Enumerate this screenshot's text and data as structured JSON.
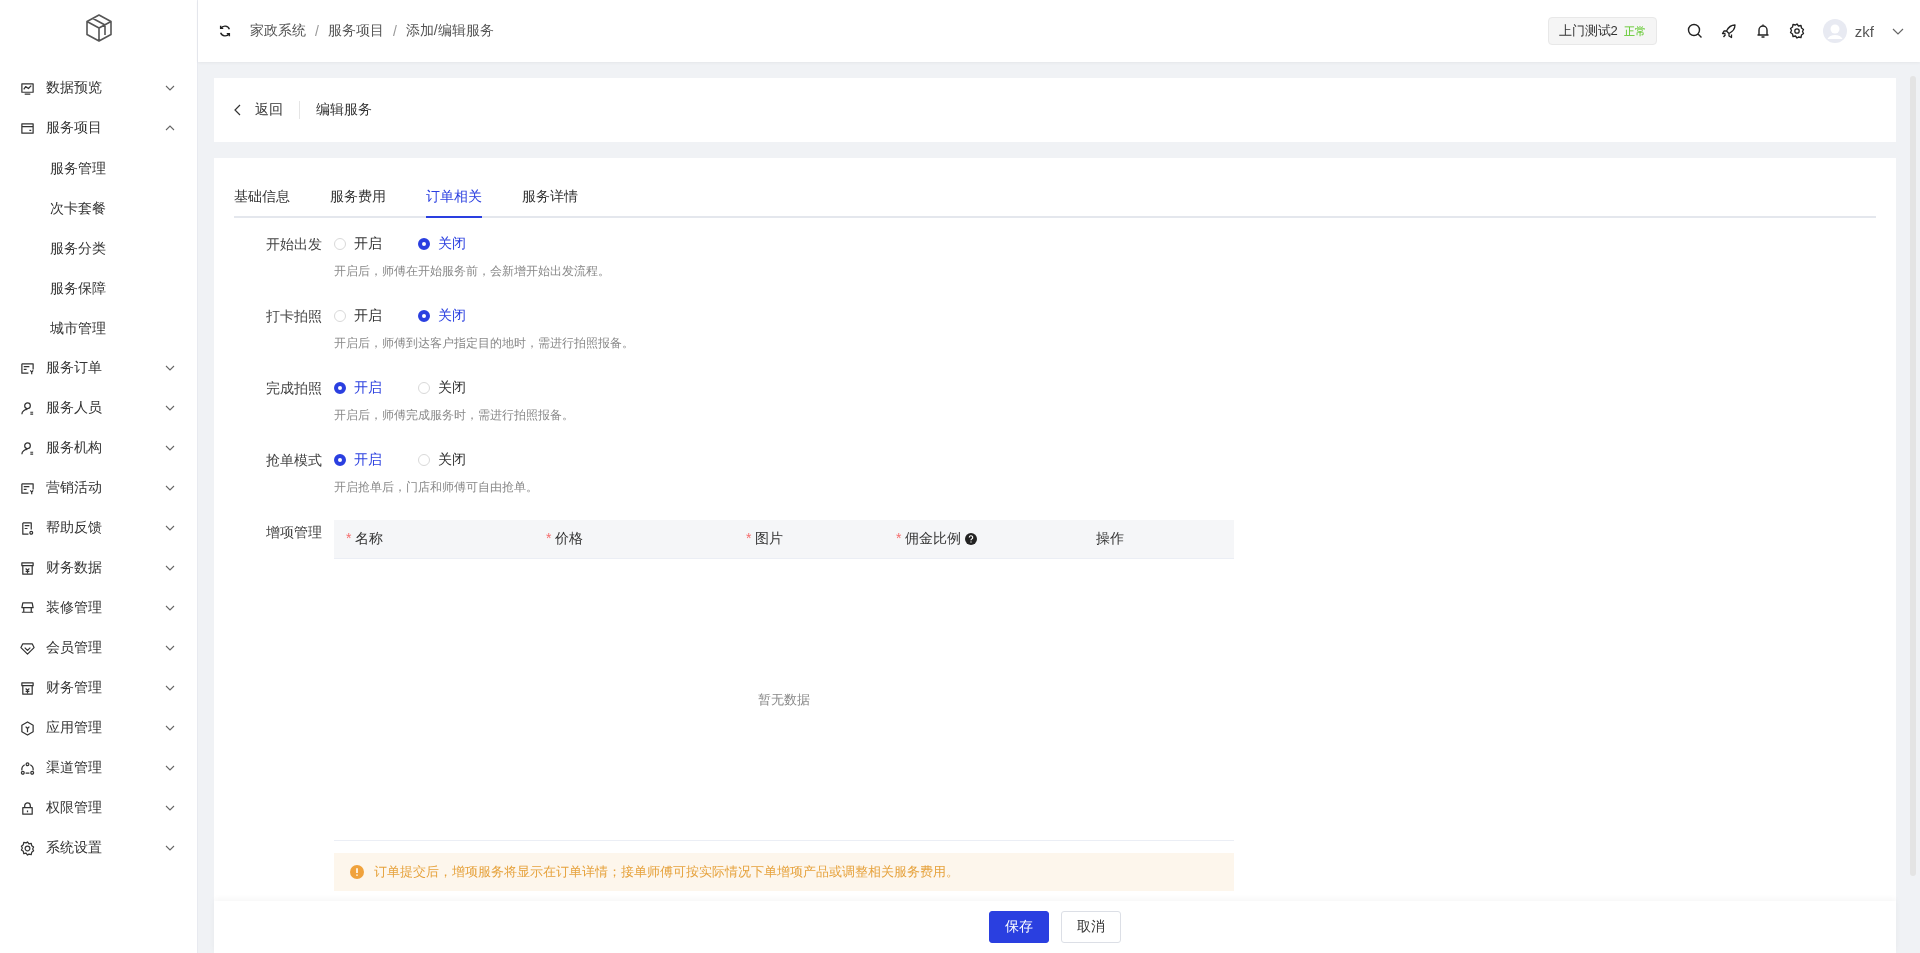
{
  "sidebar": {
    "items": [
      {
        "label": "数据预览",
        "expanded": false
      },
      {
        "label": "服务项目",
        "expanded": true,
        "children": [
          {
            "label": "服务管理"
          },
          {
            "label": "次卡套餐"
          },
          {
            "label": "服务分类"
          },
          {
            "label": "服务保障"
          },
          {
            "label": "城市管理"
          }
        ]
      },
      {
        "label": "服务订单",
        "expanded": false
      },
      {
        "label": "服务人员",
        "expanded": false
      },
      {
        "label": "服务机构",
        "expanded": false
      },
      {
        "label": "营销活动",
        "expanded": false
      },
      {
        "label": "帮助反馈",
        "expanded": false
      },
      {
        "label": "财务数据",
        "expanded": false
      },
      {
        "label": "装修管理",
        "expanded": false
      },
      {
        "label": "会员管理",
        "expanded": false
      },
      {
        "label": "财务管理",
        "expanded": false
      },
      {
        "label": "应用管理",
        "expanded": false
      },
      {
        "label": "渠道管理",
        "expanded": false
      },
      {
        "label": "权限管理",
        "expanded": false
      },
      {
        "label": "系统设置",
        "expanded": false
      }
    ]
  },
  "header": {
    "breadcrumb": [
      "家政系统",
      "服务项目",
      "添加/编辑服务"
    ],
    "separator": "/",
    "shop": {
      "name": "上门测试2",
      "status": "正常"
    },
    "user": "zkf"
  },
  "page_header": {
    "back": "返回",
    "title": "编辑服务"
  },
  "tabs": [
    {
      "label": "基础信息",
      "selected": false
    },
    {
      "label": "服务费用",
      "selected": false
    },
    {
      "label": "订单相关",
      "selected": true
    },
    {
      "label": "服务详情",
      "selected": false
    }
  ],
  "form": [
    {
      "label": "开始出发",
      "options": [
        {
          "label": "开启",
          "selected": false
        },
        {
          "label": "关闭",
          "selected": true
        }
      ],
      "hint": "开启后，师傅在开始服务前，会新增开始出发流程。"
    },
    {
      "label": "打卡拍照",
      "options": [
        {
          "label": "开启",
          "selected": false
        },
        {
          "label": "关闭",
          "selected": true
        }
      ],
      "hint": "开启后，师傅到达客户指定目的地时，需进行拍照报备。"
    },
    {
      "label": "完成拍照",
      "options": [
        {
          "label": "开启",
          "selected": true
        },
        {
          "label": "关闭",
          "selected": false
        }
      ],
      "hint": "开启后，师傅完成服务时，需进行拍照报备。"
    },
    {
      "label": "抢单模式",
      "options": [
        {
          "label": "开启",
          "selected": true
        },
        {
          "label": "关闭",
          "selected": false
        }
      ],
      "hint": "开启抢单后，门店和师傅可自由抢单。"
    }
  ],
  "addons": {
    "label": "增项管理",
    "columns": [
      {
        "label": "名称",
        "mark": "*"
      },
      {
        "label": "价格",
        "mark": "*"
      },
      {
        "label": "图片",
        "mark": "*"
      },
      {
        "label": "佣金比例",
        "mark": "*",
        "help": true
      },
      {
        "label": "操作"
      }
    ],
    "empty": "暂无数据",
    "alert": "订单提交后，增项服务将显示在订单详情；接单师傅可按实际情况下单增项产品或调整相关服务费用。"
  },
  "footer": {
    "buttons": [
      {
        "label": "保存",
        "kind": "primary"
      },
      {
        "label": "取消",
        "kind": "default"
      }
    ]
  }
}
